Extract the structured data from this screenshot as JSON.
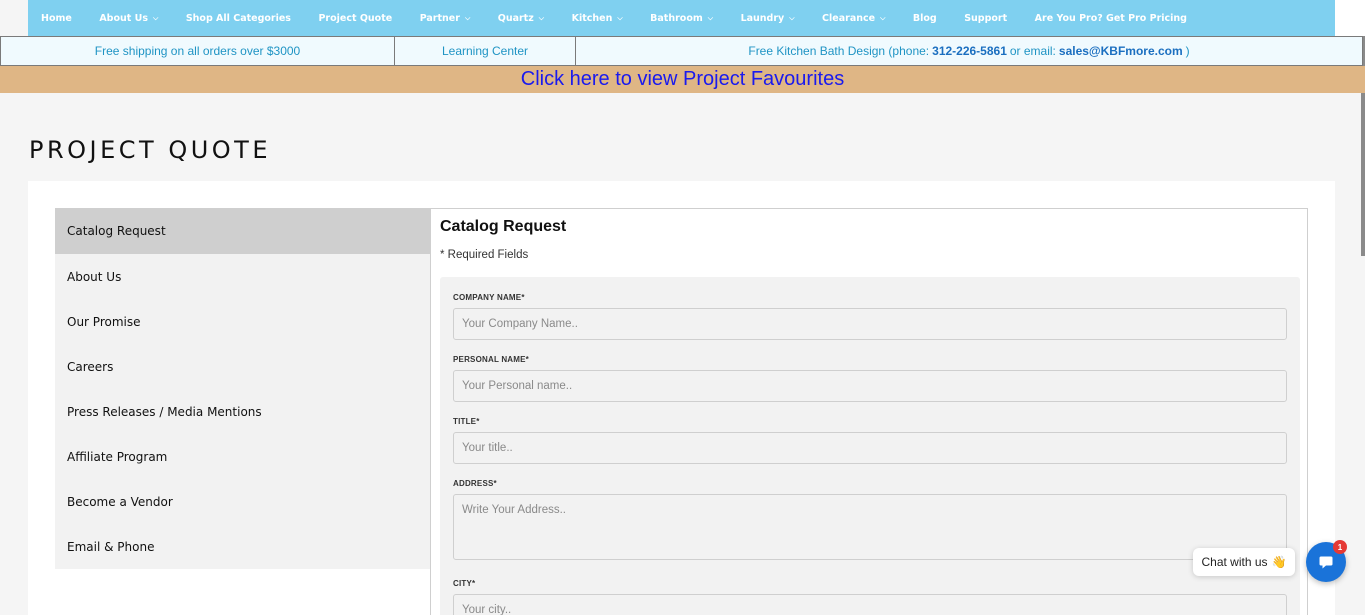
{
  "nav": {
    "items": [
      {
        "label": "Home",
        "dropdown": false
      },
      {
        "label": "About Us",
        "dropdown": true
      },
      {
        "label": "Shop All Categories",
        "dropdown": false
      },
      {
        "label": "Project Quote",
        "dropdown": false
      },
      {
        "label": "Partner",
        "dropdown": true
      },
      {
        "label": "Quartz",
        "dropdown": true
      },
      {
        "label": "Kitchen",
        "dropdown": true
      },
      {
        "label": "Bathroom",
        "dropdown": true
      },
      {
        "label": "Laundry",
        "dropdown": true
      },
      {
        "label": "Clearance",
        "dropdown": true
      },
      {
        "label": "Blog",
        "dropdown": false
      },
      {
        "label": "Support",
        "dropdown": false
      },
      {
        "label": "Are You Pro? Get Pro Pricing",
        "dropdown": false
      }
    ]
  },
  "infobar": {
    "shipping": "Free shipping on all orders over $3000",
    "learning": "Learning Center",
    "design_prefix": "Free Kitchen Bath Design (phone:",
    "phone": "312-226-5861",
    "design_mid": "or email:",
    "email": "sales@KBFmore.com",
    "design_suffix": ")"
  },
  "favourites_banner": "Click here to view Project Favourites",
  "page_title": "PROJECT QUOTE",
  "sidemenu": {
    "items": [
      {
        "label": "Catalog Request",
        "active": true
      },
      {
        "label": "About Us",
        "active": false
      },
      {
        "label": "Our Promise",
        "active": false
      },
      {
        "label": "Careers",
        "active": false
      },
      {
        "label": "Press Releases / Media Mentions",
        "active": false
      },
      {
        "label": "Affiliate Program",
        "active": false
      },
      {
        "label": "Become a Vendor",
        "active": false
      },
      {
        "label": "Email & Phone",
        "active": false
      }
    ]
  },
  "form": {
    "title": "Catalog Request",
    "required_note": "* Required Fields",
    "fields": {
      "company": {
        "label": "COMPANY NAME*",
        "placeholder": "Your Company Name..",
        "value": ""
      },
      "personal": {
        "label": "PERSONAL NAME*",
        "placeholder": "Your Personal name..",
        "value": ""
      },
      "title": {
        "label": "TITLE*",
        "placeholder": "Your title..",
        "value": ""
      },
      "address": {
        "label": "ADDRESS*",
        "placeholder": "Write Your Address..",
        "value": ""
      },
      "city": {
        "label": "CITY*",
        "placeholder": "Your city..",
        "value": ""
      }
    }
  },
  "chat": {
    "label": "Chat with us",
    "wave_icon": "👋",
    "badge_count": "1",
    "button_color": "#1a73d9"
  },
  "colors": {
    "nav_bg": "#7fd0f0",
    "banner_bg": "#dfb685",
    "banner_text": "#1a1aee",
    "info_text": "#1f94c4"
  }
}
